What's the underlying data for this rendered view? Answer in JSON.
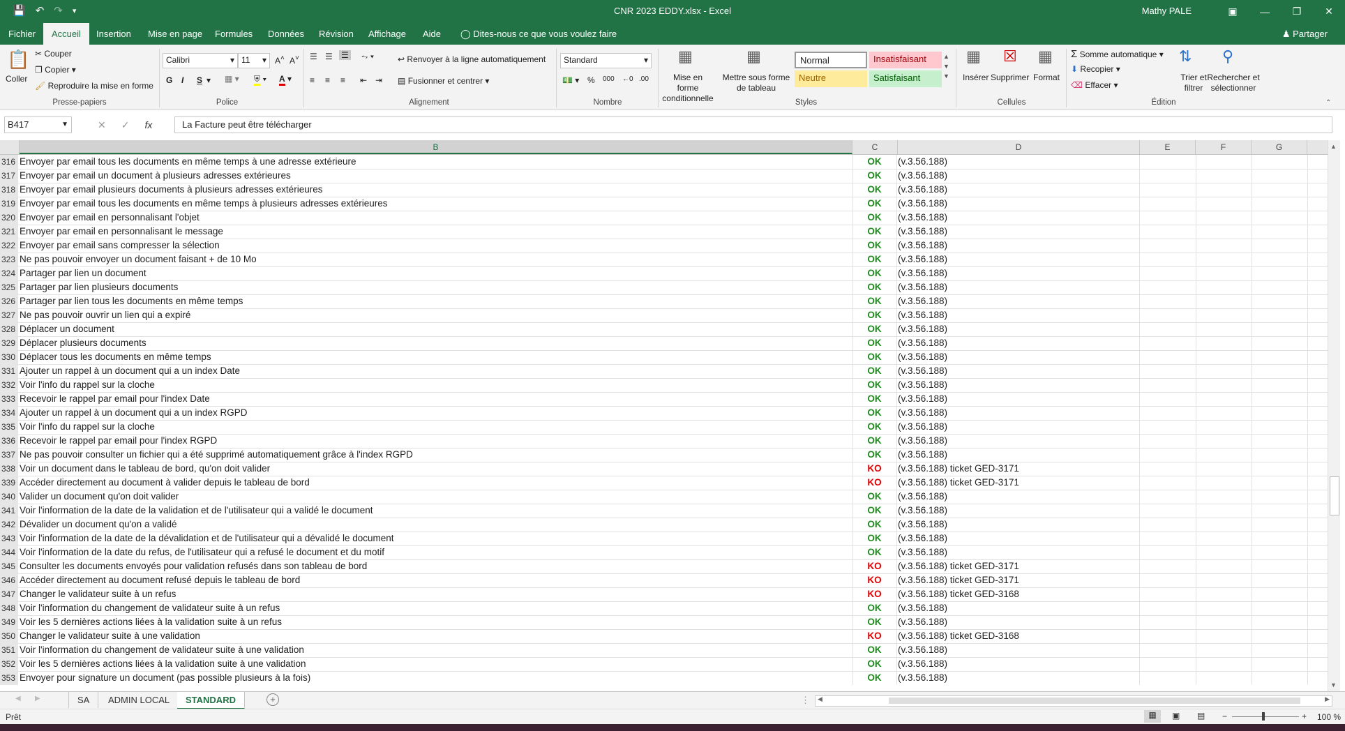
{
  "window": {
    "title": "CNR 2023 EDDY.xlsx  -  Excel",
    "user": "Mathy PALE"
  },
  "menu": {
    "tabs": [
      "Fichier",
      "Accueil",
      "Insertion",
      "Mise en page",
      "Formules",
      "Données",
      "Révision",
      "Affichage",
      "Aide"
    ],
    "tell_me": "Dites-nous ce que vous voulez faire",
    "share": "Partager"
  },
  "ribbon": {
    "clipboard": {
      "paste": "Coller",
      "cut": "Couper",
      "copy": "Copier",
      "format_painter": "Reproduire la mise en forme",
      "label": "Presse-papiers"
    },
    "font": {
      "name": "Calibri",
      "size": "11",
      "bold": "G",
      "italic": "I",
      "underline": "S",
      "label": "Police"
    },
    "alignment": {
      "wrap": "Renvoyer à la ligne automatiquement",
      "merge": "Fusionner et centrer",
      "label": "Alignement"
    },
    "number": {
      "format": "Standard",
      "percent": "%",
      "thousands": "000",
      "label": "Nombre"
    },
    "styles": {
      "conditional": "Mise en forme conditionnelle",
      "table": "Mettre sous forme de tableau",
      "normal": "Normal",
      "bad": "Insatisfaisant",
      "neutral": "Neutre",
      "good": "Satisfaisant",
      "label": "Styles"
    },
    "cells": {
      "insert": "Insérer",
      "delete": "Supprimer",
      "format": "Format",
      "label": "Cellules"
    },
    "editing": {
      "autosum": "Somme automatique",
      "fill": "Recopier",
      "clear": "Effacer",
      "sort": "Trier et filtrer",
      "find": "Rechercher et sélectionner",
      "label": "Édition"
    }
  },
  "formula_bar": {
    "name_box": "B417",
    "content": "La Facture peut être télécharger"
  },
  "columns": [
    "B",
    "C",
    "D",
    "E",
    "F",
    "G"
  ],
  "rows": [
    {
      "n": "316",
      "b": "Envoyer par email tous les documents en même temps à une adresse extérieure",
      "c": "OK",
      "d": "(v.3.56.188)",
      "t": ""
    },
    {
      "n": "317",
      "b": "Envoyer par email un document à plusieurs adresses extérieures",
      "c": "OK",
      "d": "(v.3.56.188)",
      "t": ""
    },
    {
      "n": "318",
      "b": "Envoyer par email plusieurs documents à plusieurs adresses extérieures",
      "c": "OK",
      "d": "(v.3.56.188)",
      "t": ""
    },
    {
      "n": "319",
      "b": "Envoyer par email tous les documents en même temps à plusieurs adresses extérieures",
      "c": "OK",
      "d": "(v.3.56.188)",
      "t": ""
    },
    {
      "n": "320",
      "b": "Envoyer par email en personnalisant l'objet",
      "c": "OK",
      "d": "(v.3.56.188)",
      "t": ""
    },
    {
      "n": "321",
      "b": "Envoyer par email en personnalisant le message",
      "c": "OK",
      "d": "(v.3.56.188)",
      "t": ""
    },
    {
      "n": "322",
      "b": "Envoyer par email sans compresser la sélection",
      "c": "OK",
      "d": "(v.3.56.188)",
      "t": ""
    },
    {
      "n": "323",
      "b": "Ne pas pouvoir envoyer un document faisant + de 10 Mo",
      "c": "OK",
      "d": "(v.3.56.188)",
      "t": ""
    },
    {
      "n": "324",
      "b": "Partager par lien un document",
      "c": "OK",
      "d": "(v.3.56.188)",
      "t": ""
    },
    {
      "n": "325",
      "b": "Partager par lien plusieurs documents",
      "c": "OK",
      "d": "(v.3.56.188)",
      "t": ""
    },
    {
      "n": "326",
      "b": "Partager par lien tous les documents en même temps",
      "c": "OK",
      "d": "(v.3.56.188)",
      "t": ""
    },
    {
      "n": "327",
      "b": "Ne pas pouvoir ouvrir un lien qui a expiré",
      "c": "OK",
      "d": "(v.3.56.188)",
      "t": ""
    },
    {
      "n": "328",
      "b": "Déplacer un document",
      "c": "OK",
      "d": "(v.3.56.188)",
      "t": ""
    },
    {
      "n": "329",
      "b": "Déplacer plusieurs documents",
      "c": "OK",
      "d": "(v.3.56.188)",
      "t": ""
    },
    {
      "n": "330",
      "b": "Déplacer tous les documents en même temps",
      "c": "OK",
      "d": "(v.3.56.188)",
      "t": ""
    },
    {
      "n": "331",
      "b": "Ajouter un rappel à un document qui a un index Date",
      "c": "OK",
      "d": "(v.3.56.188)",
      "t": ""
    },
    {
      "n": "332",
      "b": "Voir l'info du rappel sur la cloche",
      "c": "OK",
      "d": "(v.3.56.188)",
      "t": ""
    },
    {
      "n": "333",
      "b": "Recevoir le rappel par email pour l'index Date",
      "c": "OK",
      "d": "(v.3.56.188)",
      "t": ""
    },
    {
      "n": "334",
      "b": "Ajouter un rappel à un document qui a un index RGPD",
      "c": "OK",
      "d": "(v.3.56.188)",
      "t": ""
    },
    {
      "n": "335",
      "b": "Voir l'info du rappel sur la cloche",
      "c": "OK",
      "d": "(v.3.56.188)",
      "t": ""
    },
    {
      "n": "336",
      "b": "Recevoir le rappel par email pour l'index RGPD",
      "c": "OK",
      "d": "(v.3.56.188)",
      "t": ""
    },
    {
      "n": "337",
      "b": "Ne pas pouvoir consulter un fichier qui a été supprimé automatiquement grâce à l'index RGPD",
      "c": "OK",
      "d": "(v.3.56.188)",
      "t": ""
    },
    {
      "n": "338",
      "b": "Voir un document dans le tableau de bord, qu'on doit valider",
      "c": "KO",
      "d": "(v.3.56.188)",
      "t": " ticket GED-3171"
    },
    {
      "n": "339",
      "b": "Accéder directement au document à valider depuis le tableau de bord",
      "c": "KO",
      "d": "(v.3.56.188)",
      "t": " ticket GED-3171"
    },
    {
      "n": "340",
      "b": "Valider un document qu'on doit valider",
      "c": "OK",
      "d": "(v.3.56.188)",
      "t": ""
    },
    {
      "n": "341",
      "b": "Voir l'information de la date de la validation et de l'utilisateur qui a validé le document",
      "c": "OK",
      "d": "(v.3.56.188)",
      "t": ""
    },
    {
      "n": "342",
      "b": "Dévalider un document qu'on a validé",
      "c": "OK",
      "d": "(v.3.56.188)",
      "t": ""
    },
    {
      "n": "343",
      "b": "Voir l'information de la date de la dévalidation et de l'utilisateur qui a dévalidé le document",
      "c": "OK",
      "d": "(v.3.56.188)",
      "t": ""
    },
    {
      "n": "344",
      "b": "Voir l'information de la date du refus, de l'utilisateur qui a refusé le document et du motif",
      "c": "OK",
      "d": "(v.3.56.188)",
      "t": ""
    },
    {
      "n": "345",
      "b": "Consulter les documents envoyés pour validation refusés dans son tableau de bord",
      "c": "KO",
      "d": "(v.3.56.188)",
      "t": " ticket GED-3171"
    },
    {
      "n": "346",
      "b": "Accéder directement au document refusé depuis le tableau de bord",
      "c": "KO",
      "d": "(v.3.56.188)",
      "t": " ticket GED-3171"
    },
    {
      "n": "347",
      "b": "Changer le validateur suite à un refus",
      "c": "KO",
      "d": "(v.3.56.188)",
      "t": " ticket GED-3168"
    },
    {
      "n": "348",
      "b": "Voir l'information du changement de validateur suite à un refus",
      "c": "OK",
      "d": "(v.3.56.188)",
      "t": ""
    },
    {
      "n": "349",
      "b": "Voir les 5 dernières actions liées à la validation suite à un refus",
      "c": "OK",
      "d": "(v.3.56.188)",
      "t": ""
    },
    {
      "n": "350",
      "b": "Changer le validateur suite à une validation",
      "c": "KO",
      "d": "(v.3.56.188)",
      "t": " ticket GED-3168"
    },
    {
      "n": "351",
      "b": "Voir l'information du changement de validateur suite à une validation",
      "c": "OK",
      "d": "(v.3.56.188)",
      "t": ""
    },
    {
      "n": "352",
      "b": "Voir les 5 dernières actions liées à la validation suite à une validation",
      "c": "OK",
      "d": "(v.3.56.188)",
      "t": ""
    },
    {
      "n": "353",
      "b": "Envoyer pour signature un document (pas possible plusieurs à la fois)",
      "c": "OK",
      "d": "(v.3.56.188)",
      "t": ""
    }
  ],
  "sheets": {
    "tabs": [
      "SA",
      "ADMIN LOCAL",
      "STANDARD"
    ],
    "active": "STANDARD"
  },
  "status": {
    "ready": "Prêt",
    "zoom": "100 %"
  },
  "colors": {
    "accent": "#217346",
    "ok": "#1e8c1e",
    "ko": "#e00000"
  }
}
